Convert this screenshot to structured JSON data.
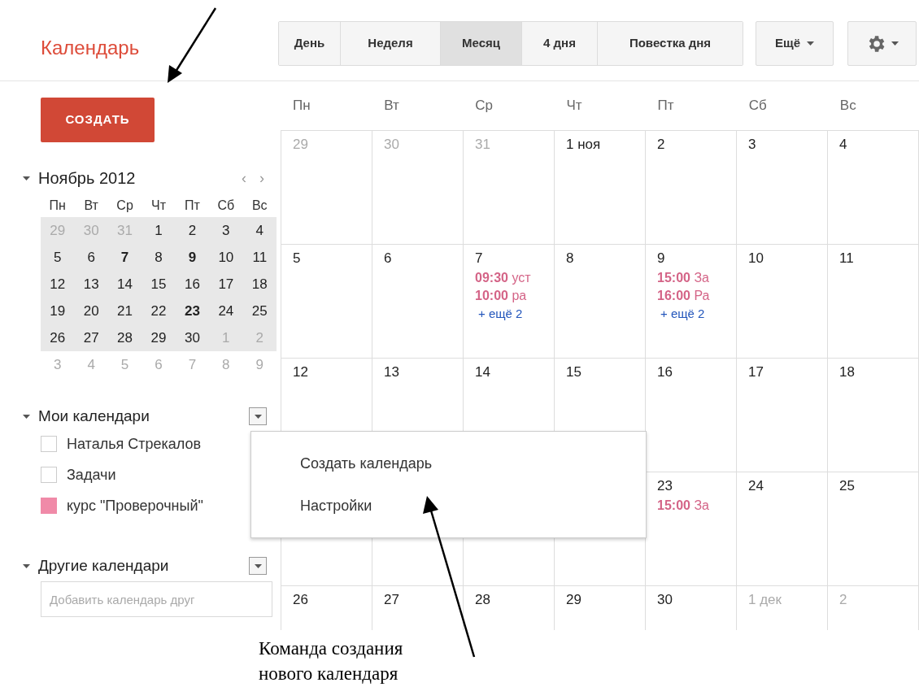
{
  "app_title": "Календарь",
  "view_tabs": [
    {
      "label": "День",
      "selected": false
    },
    {
      "label": "Неделя",
      "selected": false
    },
    {
      "label": "Месяц",
      "selected": true
    },
    {
      "label": "4 дня",
      "selected": false
    },
    {
      "label": "Повестка дня",
      "selected": false
    }
  ],
  "more_button": {
    "label": "Ещё"
  },
  "create_button": {
    "label": "СОЗДАТЬ"
  },
  "mini_calendar": {
    "title": "Ноябрь 2012",
    "expanded": true,
    "prev": "‹",
    "next": "›",
    "weekdays": [
      "Пн",
      "Вт",
      "Ср",
      "Чт",
      "Пт",
      "Сб",
      "Вс"
    ],
    "weeks": [
      {
        "highlighted": true,
        "days": [
          {
            "label": "29",
            "other_month": true,
            "bold": false
          },
          {
            "label": "30",
            "other_month": true,
            "bold": false
          },
          {
            "label": "31",
            "other_month": true,
            "bold": false
          },
          {
            "label": "1",
            "other_month": false,
            "bold": false
          },
          {
            "label": "2",
            "other_month": false,
            "bold": false
          },
          {
            "label": "3",
            "other_month": false,
            "bold": false
          },
          {
            "label": "4",
            "other_month": false,
            "bold": false
          }
        ]
      },
      {
        "highlighted": true,
        "days": [
          {
            "label": "5",
            "other_month": false,
            "bold": false
          },
          {
            "label": "6",
            "other_month": false,
            "bold": false
          },
          {
            "label": "7",
            "other_month": false,
            "bold": true
          },
          {
            "label": "8",
            "other_month": false,
            "bold": false
          },
          {
            "label": "9",
            "other_month": false,
            "bold": true
          },
          {
            "label": "10",
            "other_month": false,
            "bold": false
          },
          {
            "label": "11",
            "other_month": false,
            "bold": false
          }
        ]
      },
      {
        "highlighted": true,
        "days": [
          {
            "label": "12",
            "other_month": false,
            "bold": false
          },
          {
            "label": "13",
            "other_month": false,
            "bold": false
          },
          {
            "label": "14",
            "other_month": false,
            "bold": false
          },
          {
            "label": "15",
            "other_month": false,
            "bold": false
          },
          {
            "label": "16",
            "other_month": false,
            "bold": false
          },
          {
            "label": "17",
            "other_month": false,
            "bold": false
          },
          {
            "label": "18",
            "other_month": false,
            "bold": false
          }
        ]
      },
      {
        "highlighted": true,
        "days": [
          {
            "label": "19",
            "other_month": false,
            "bold": false
          },
          {
            "label": "20",
            "other_month": false,
            "bold": false
          },
          {
            "label": "21",
            "other_month": false,
            "bold": false
          },
          {
            "label": "22",
            "other_month": false,
            "bold": false
          },
          {
            "label": "23",
            "other_month": false,
            "bold": true
          },
          {
            "label": "24",
            "other_month": false,
            "bold": false
          },
          {
            "label": "25",
            "other_month": false,
            "bold": false
          }
        ]
      },
      {
        "highlighted": true,
        "days": [
          {
            "label": "26",
            "other_month": false,
            "bold": false
          },
          {
            "label": "27",
            "other_month": false,
            "bold": false
          },
          {
            "label": "28",
            "other_month": false,
            "bold": false
          },
          {
            "label": "29",
            "other_month": false,
            "bold": false
          },
          {
            "label": "30",
            "other_month": false,
            "bold": false
          },
          {
            "label": "1",
            "other_month": true,
            "bold": false
          },
          {
            "label": "2",
            "other_month": true,
            "bold": false
          }
        ]
      },
      {
        "highlighted": false,
        "days": [
          {
            "label": "3",
            "other_month": true,
            "bold": false
          },
          {
            "label": "4",
            "other_month": true,
            "bold": false
          },
          {
            "label": "5",
            "other_month": true,
            "bold": false
          },
          {
            "label": "6",
            "other_month": true,
            "bold": false
          },
          {
            "label": "7",
            "other_month": true,
            "bold": false
          },
          {
            "label": "8",
            "other_month": true,
            "bold": false
          },
          {
            "label": "9",
            "other_month": true,
            "bold": false
          }
        ]
      }
    ]
  },
  "my_calendars": {
    "title": "Мои календари",
    "expanded": true,
    "items": [
      {
        "label": "Наталья Стрекалов",
        "checked": false
      },
      {
        "label": "Задачи",
        "checked": false
      },
      {
        "label": "курс \"Проверочный\"",
        "checked": true,
        "color": "#f08aa8"
      }
    ]
  },
  "other_calendars": {
    "title": "Другие календари",
    "expanded": true,
    "placeholder": "Добавить календарь друг"
  },
  "calendar_menu": {
    "items": [
      "Создать календарь",
      "Настройки"
    ]
  },
  "month_grid": {
    "weekdays": [
      "Пн",
      "Вт",
      "Ср",
      "Чт",
      "Пт",
      "Сб",
      "Вс"
    ],
    "weeks": [
      [
        {
          "label": "29",
          "other_month": true
        },
        {
          "label": "30",
          "other_month": true
        },
        {
          "label": "31",
          "other_month": true
        },
        {
          "label": "1 ноя",
          "other_month": false
        },
        {
          "label": "2",
          "other_month": false
        },
        {
          "label": "3",
          "other_month": false
        },
        {
          "label": "4",
          "other_month": false
        }
      ],
      [
        {
          "label": "5",
          "other_month": false
        },
        {
          "label": "6",
          "other_month": false
        },
        {
          "label": "7",
          "other_month": false,
          "events": [
            {
              "time": "09:30",
              "title": "уст"
            },
            {
              "time": "10:00",
              "title": "ра"
            }
          ],
          "more": "+ ещё 2"
        },
        {
          "label": "8",
          "other_month": false
        },
        {
          "label": "9",
          "other_month": false,
          "events": [
            {
              "time": "15:00",
              "title": "За"
            },
            {
              "time": "16:00",
              "title": "Ра"
            }
          ],
          "more": "+ ещё 2"
        },
        {
          "label": "10",
          "other_month": false
        },
        {
          "label": "11",
          "other_month": false
        }
      ],
      [
        {
          "label": "12",
          "other_month": false
        },
        {
          "label": "13",
          "other_month": false
        },
        {
          "label": "14",
          "other_month": false
        },
        {
          "label": "15",
          "other_month": false
        },
        {
          "label": "16",
          "other_month": false
        },
        {
          "label": "17",
          "other_month": false
        },
        {
          "label": "18",
          "other_month": false
        }
      ],
      [
        {
          "label": "23",
          "other_month": false,
          "events": [
            {
              "time": "15:00",
              "title": "За"
            }
          ]
        },
        {
          "label": "24",
          "other_month": false
        },
        {
          "label": "25",
          "other_month": false
        }
      ],
      [
        {
          "label": "26",
          "other_month": false
        },
        {
          "label": "27",
          "other_month": false
        },
        {
          "label": "28",
          "other_month": false
        },
        {
          "label": "29",
          "other_month": false
        },
        {
          "label": "30",
          "other_month": false
        },
        {
          "label": "1 дек",
          "other_month": true
        },
        {
          "label": "2",
          "other_month": true
        }
      ]
    ]
  },
  "annotation": {
    "caption_lines": [
      "Команда создания",
      "нового календаря"
    ]
  }
}
